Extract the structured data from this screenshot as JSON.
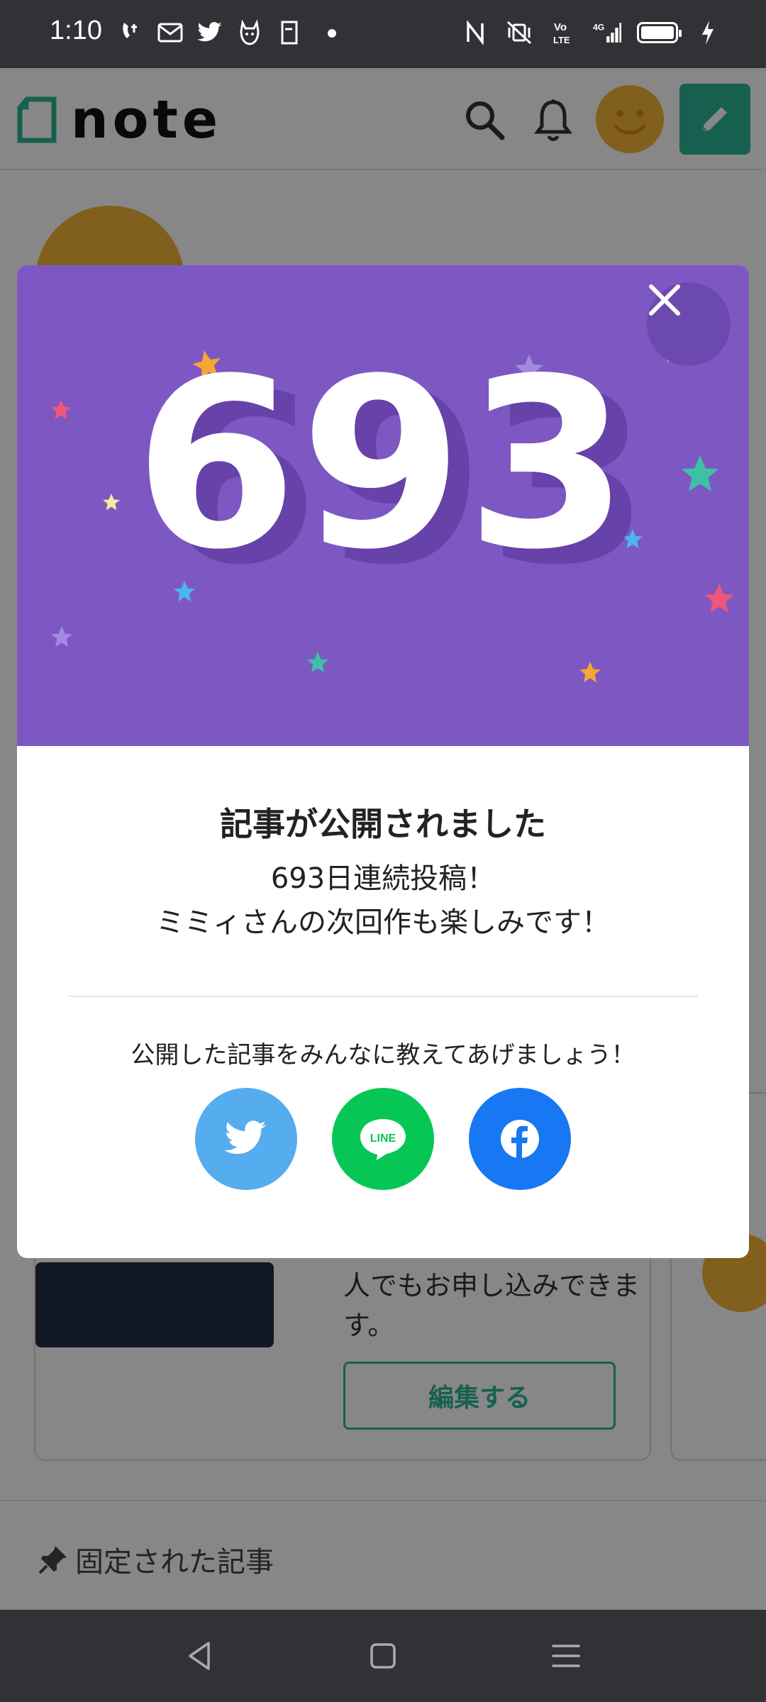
{
  "status_bar": {
    "time": "1:10",
    "notification_icons": [
      "missed-call-icon",
      "mail-icon",
      "twitter-icon",
      "cat-app-icon",
      "document-icon"
    ],
    "system_icons": [
      "nfc-icon",
      "vibrate-mute-icon",
      "volte-icon",
      "signal-4g-icon",
      "battery-icon",
      "charging-icon"
    ],
    "network_label": "4G",
    "volte_label": "Vo LTE"
  },
  "header": {
    "logo_text": "note",
    "icons": [
      "search-icon",
      "bell-icon",
      "avatar",
      "pen-icon"
    ],
    "brand_color": "#2cb696"
  },
  "background_page": {
    "card_desc": "人でもお申し込みできます。",
    "edit_button": "編集する",
    "pinned_label": "固定された記事"
  },
  "modal": {
    "count": "693",
    "hero_color": "#7d58c2",
    "title": "記事が公開されました",
    "message_line1": "693日連続投稿！",
    "message_line2": "ミミィさんの次回作も楽しみです！",
    "share_prompt": "公開した記事をみんなに教えてあげましょう！",
    "share_buttons": [
      {
        "name": "twitter",
        "color": "#55acee"
      },
      {
        "name": "line",
        "label": "LINE",
        "color": "#06c755"
      },
      {
        "name": "facebook",
        "color": "#1877f2"
      }
    ]
  },
  "nav_bar": {
    "buttons": [
      "back-icon",
      "home-icon",
      "menu-icon"
    ]
  }
}
